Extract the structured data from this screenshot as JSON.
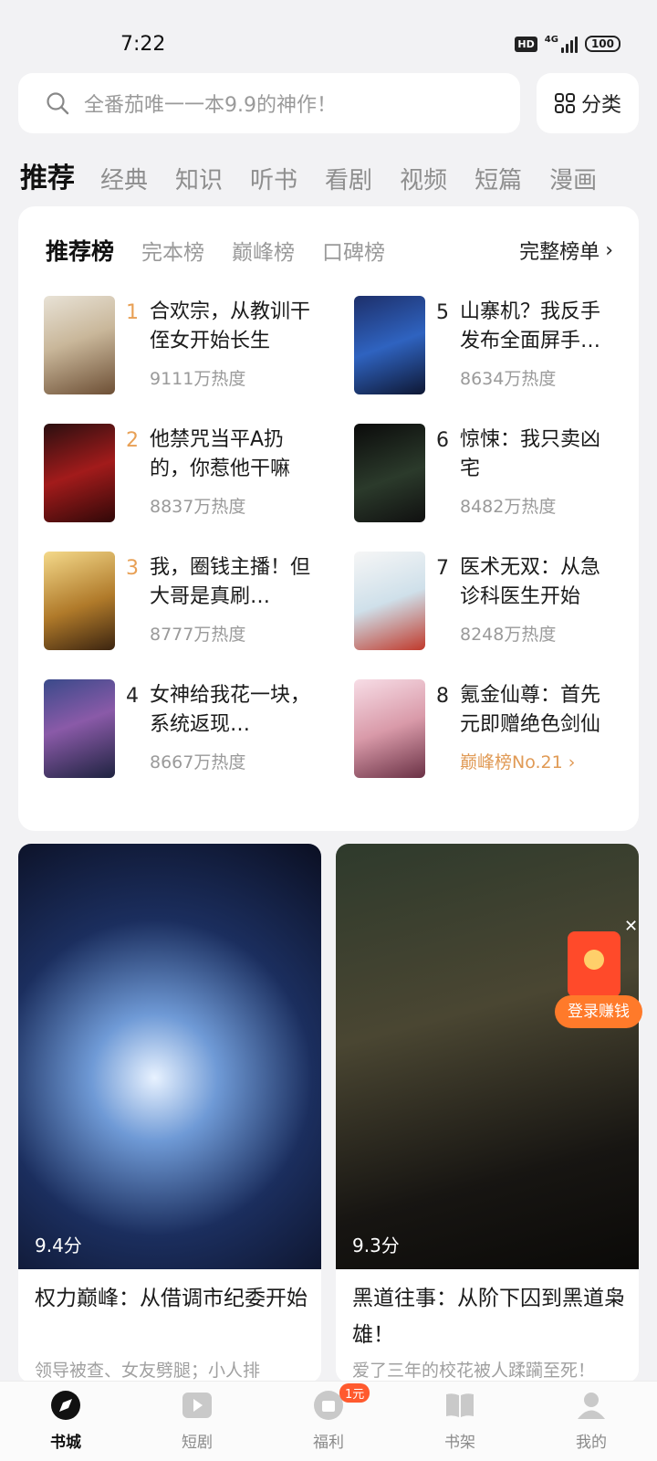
{
  "status_bar": {
    "time": "7:22",
    "hd": "HD",
    "network": "4G",
    "battery": "100"
  },
  "search": {
    "placeholder": "全番茄唯一一本9.9的神作！",
    "category_label": "分类"
  },
  "top_tabs": [
    "推荐",
    "经典",
    "知识",
    "听书",
    "看剧",
    "视频",
    "短篇",
    "漫画"
  ],
  "ranking": {
    "tabs": [
      "推荐榜",
      "完本榜",
      "巅峰榜",
      "口碑榜"
    ],
    "more_label": "完整榜单",
    "items": [
      {
        "rank": "1",
        "title": "合欢宗，从教训干侄女开始长生",
        "heat": "9111万热度"
      },
      {
        "rank": "2",
        "title": "他禁咒当平A扔的，你惹他干嘛",
        "heat": "8837万热度"
      },
      {
        "rank": "3",
        "title": "我，圈钱主播！但大哥是真刷…",
        "heat": "8777万热度"
      },
      {
        "rank": "4",
        "title": "女神给我花一块，系统返现…",
        "heat": "8667万热度"
      },
      {
        "rank": "5",
        "title": "山寨机？我反手发布全面屏手…",
        "heat": "8634万热度"
      },
      {
        "rank": "6",
        "title": "惊悚：我只卖凶宅",
        "heat": "8482万热度"
      },
      {
        "rank": "7",
        "title": "医术无双：从急诊科医生开始",
        "heat": "8248万热度"
      },
      {
        "rank": "8",
        "title": "氪金仙尊：首先元即赠绝色剑仙",
        "heat": "巅峰榜No.21"
      }
    ]
  },
  "features": [
    {
      "title": "权力巅峰：从借调市纪委开始",
      "score": "9.4分",
      "desc": "领导被查、女友劈腿；小人排"
    },
    {
      "title": "黑道往事：从阶下囚到黑道枭雄！",
      "score": "9.3分",
      "desc": "爱了三年的校花被人蹂躏至死！"
    }
  ],
  "login_badge": "登录赚钱",
  "nav": [
    {
      "label": "书城",
      "icon": "compass-icon"
    },
    {
      "label": "短剧",
      "icon": "play-icon"
    },
    {
      "label": "福利",
      "icon": "gift-icon",
      "badge": "1元"
    },
    {
      "label": "书架",
      "icon": "book-icon"
    },
    {
      "label": "我的",
      "icon": "person-icon"
    }
  ],
  "colors": {
    "accent_orange": "#e8a055",
    "badge_red": "#ff5a2e",
    "login_orange": "#ff7a2a"
  }
}
